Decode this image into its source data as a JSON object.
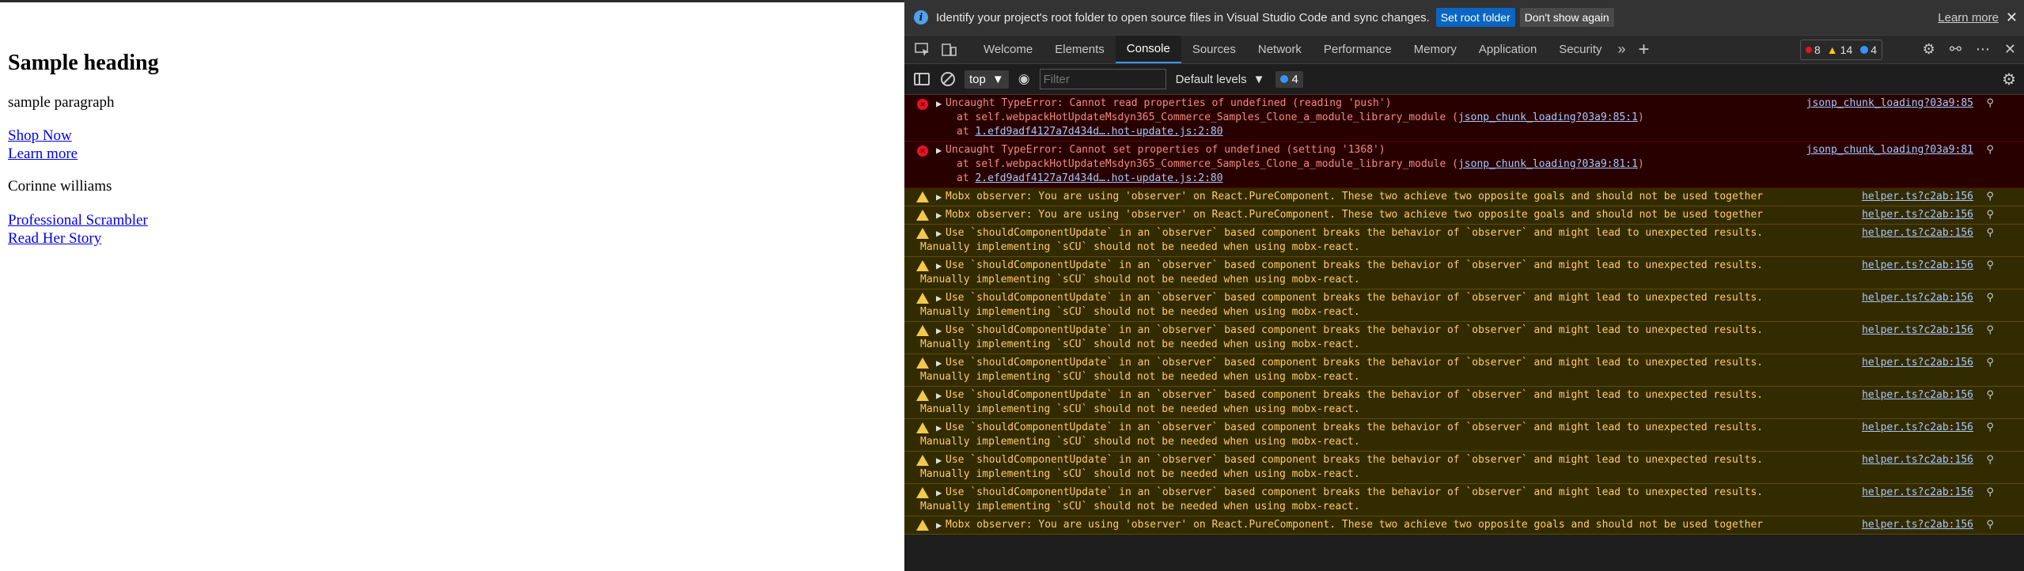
{
  "page": {
    "heading": "Sample heading",
    "paragraph": "sample paragraph",
    "links1": [
      "Shop Now",
      "Learn more"
    ],
    "person_name": "Corinne williams",
    "links2": [
      "Professional Scrambler",
      "Read Her Story"
    ]
  },
  "devtools": {
    "infobar": {
      "message": "Identify your project's root folder to open source files in Visual Studio Code and sync changes.",
      "primary_button": "Set root folder",
      "secondary_button": "Don't show again",
      "learn_more": "Learn more",
      "close": "✕"
    },
    "tabs": [
      "Welcome",
      "Elements",
      "Console",
      "Sources",
      "Network",
      "Performance",
      "Memory",
      "Application",
      "Security"
    ],
    "active_tab": "Console",
    "counts": {
      "errors": "8",
      "warnings": "14",
      "issues": "4"
    },
    "console_toolbar": {
      "context": "top",
      "filter_placeholder": "Filter",
      "levels": "Default levels",
      "issues_count": "4"
    },
    "messages": [
      {
        "level": "error",
        "text": "Uncaught TypeError: Cannot read properties of undefined (reading 'push')",
        "stack_prefix1": "at self.webpackHotUpdateMsdyn365_Commerce_Samples_Clone_a_module_library_module (",
        "stack_link1": "jsonp_chunk_loading?03a9:85:1",
        "stack_suffix1": ")",
        "stack_prefix2": "at ",
        "stack_link2": "1.efd9adf4127a7d434d….hot-update.js:2:80",
        "source": "jsonp_chunk_loading?03a9:85"
      },
      {
        "level": "error",
        "text": "Uncaught TypeError: Cannot set properties of undefined (setting '1368')",
        "stack_prefix1": "at self.webpackHotUpdateMsdyn365_Commerce_Samples_Clone_a_module_library_module (",
        "stack_link1": "jsonp_chunk_loading?03a9:81:1",
        "stack_suffix1": ")",
        "stack_prefix2": "at ",
        "stack_link2": "2.efd9adf4127a7d434d….hot-update.js:2:80",
        "source": "jsonp_chunk_loading?03a9:81"
      },
      {
        "level": "warning",
        "text": "Mobx observer: You are using 'observer' on React.PureComponent. These two achieve two opposite goals and should not be used together",
        "source": "helper.ts?c2ab:156"
      },
      {
        "level": "warning",
        "text": "Mobx observer: You are using 'observer' on React.PureComponent. These two achieve two opposite goals and should not be used together",
        "source": "helper.ts?c2ab:156"
      },
      {
        "level": "warning",
        "text": "Use `shouldComponentUpdate` in an `observer` based component breaks the behavior of `observer` and might lead to unexpected results.",
        "cont": "Manually implementing `sCU` should not be needed when using mobx-react.",
        "source": "helper.ts?c2ab:156"
      },
      {
        "level": "warning",
        "text": "Use `shouldComponentUpdate` in an `observer` based component breaks the behavior of `observer` and might lead to unexpected results.",
        "cont": "Manually implementing `sCU` should not be needed when using mobx-react.",
        "source": "helper.ts?c2ab:156"
      },
      {
        "level": "warning",
        "text": "Use `shouldComponentUpdate` in an `observer` based component breaks the behavior of `observer` and might lead to unexpected results.",
        "cont": "Manually implementing `sCU` should not be needed when using mobx-react.",
        "source": "helper.ts?c2ab:156"
      },
      {
        "level": "warning",
        "text": "Use `shouldComponentUpdate` in an `observer` based component breaks the behavior of `observer` and might lead to unexpected results.",
        "cont": "Manually implementing `sCU` should not be needed when using mobx-react.",
        "source": "helper.ts?c2ab:156"
      },
      {
        "level": "warning",
        "text": "Use `shouldComponentUpdate` in an `observer` based component breaks the behavior of `observer` and might lead to unexpected results.",
        "cont": "Manually implementing `sCU` should not be needed when using mobx-react.",
        "source": "helper.ts?c2ab:156"
      },
      {
        "level": "warning",
        "text": "Use `shouldComponentUpdate` in an `observer` based component breaks the behavior of `observer` and might lead to unexpected results.",
        "cont": "Manually implementing `sCU` should not be needed when using mobx-react.",
        "source": "helper.ts?c2ab:156"
      },
      {
        "level": "warning",
        "text": "Use `shouldComponentUpdate` in an `observer` based component breaks the behavior of `observer` and might lead to unexpected results.",
        "cont": "Manually implementing `sCU` should not be needed when using mobx-react.",
        "source": "helper.ts?c2ab:156"
      },
      {
        "level": "warning",
        "text": "Use `shouldComponentUpdate` in an `observer` based component breaks the behavior of `observer` and might lead to unexpected results.",
        "cont": "Manually implementing `sCU` should not be needed when using mobx-react.",
        "source": "helper.ts?c2ab:156"
      },
      {
        "level": "warning",
        "text": "Use `shouldComponentUpdate` in an `observer` based component breaks the behavior of `observer` and might lead to unexpected results.",
        "cont": "Manually implementing `sCU` should not be needed when using mobx-react.",
        "source": "helper.ts?c2ab:156"
      },
      {
        "level": "warning",
        "text": "Mobx observer: You are using 'observer' on React.PureComponent. These two achieve two opposite goals and should not be used together",
        "source": "helper.ts?c2ab:156"
      }
    ]
  }
}
